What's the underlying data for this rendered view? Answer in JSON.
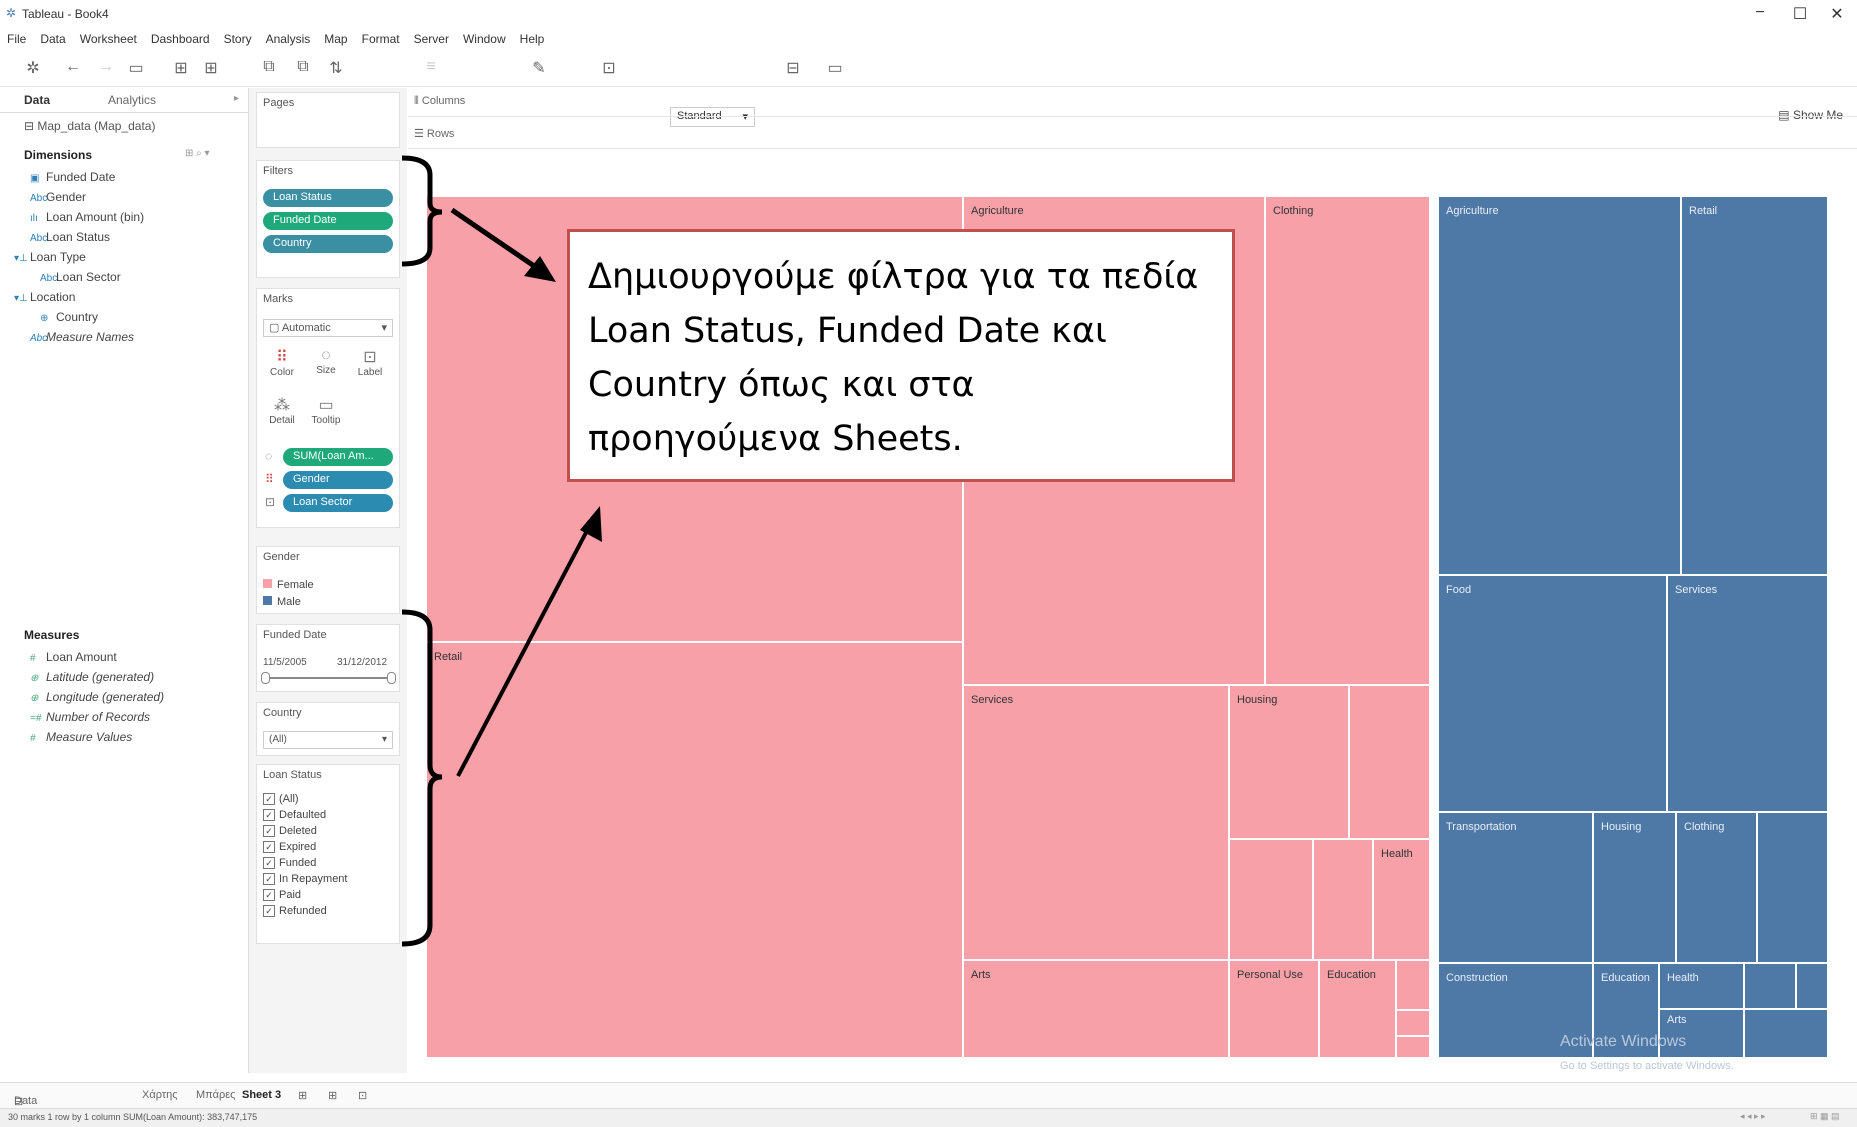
{
  "window": {
    "title": "Tableau - Book4",
    "min": "−",
    "max": "☐",
    "close": "✕"
  },
  "menu": [
    "File",
    "Data",
    "Worksheet",
    "Dashboard",
    "Story",
    "Analysis",
    "Map",
    "Format",
    "Server",
    "Window",
    "Help"
  ],
  "toolbar": {
    "fit_select": "Standard",
    "show_me": "Show Me"
  },
  "left_panel": {
    "tabs": [
      "Data",
      "Analytics"
    ],
    "datasource": "Map_data (Map_data)",
    "dimensions_title": "Dimensions",
    "dimensions": [
      "Funded Date",
      "Gender",
      "Loan Amount (bin)",
      "Loan Status",
      "Loan Type",
      "Loan Sector",
      "Location",
      "Country",
      "Measure Names"
    ],
    "measures_title": "Measures",
    "measures": [
      "Loan Amount",
      "Latitude (generated)",
      "Longitude (generated)",
      "Number of Records",
      "Measure Values"
    ]
  },
  "pages": {
    "title": "Pages"
  },
  "filters": {
    "title": "Filters",
    "pills": [
      "Loan Status",
      "Funded Date",
      "Country"
    ]
  },
  "marks": {
    "title": "Marks",
    "type": "Automatic",
    "buttons": [
      "Color",
      "Size",
      "Label",
      "Detail",
      "Tooltip"
    ],
    "pills": [
      "SUM(Loan Am...",
      "Gender",
      "Loan Sector"
    ]
  },
  "legend": {
    "title": "Gender",
    "items": [
      {
        "label": "Female",
        "color": "#f8a0a8"
      },
      {
        "label": "Male",
        "color": "#4e79a7"
      }
    ]
  },
  "funded_date": {
    "title": "Funded Date",
    "from": "11/5/2005",
    "to": "31/12/2012"
  },
  "country": {
    "title": "Country",
    "value": "(All)"
  },
  "loan_status": {
    "title": "Loan Status",
    "items": [
      "(All)",
      "Defaulted",
      "Deleted",
      "Expired",
      "Funded",
      "In Repayment",
      "Paid",
      "Refunded"
    ]
  },
  "shelves": {
    "columns": "Columns",
    "rows": "Rows"
  },
  "treemap": {
    "female_labels": [
      "Retail",
      "Agriculture",
      "Clothing",
      "Services",
      "Housing",
      "Health",
      "Arts",
      "Personal Use",
      "Education"
    ],
    "male_labels": [
      "Agriculture",
      "Retail",
      "Food",
      "Services",
      "Transportation",
      "Housing",
      "Clothing",
      "Construction",
      "Education",
      "Health",
      "Arts"
    ]
  },
  "callout": {
    "text": "Δημιουργούμε φίλτρα για τα πεδία Loan Status, Funded Date και Country όπως και στα προηγούμενα Sheets."
  },
  "sheet_tabs": {
    "datasource": "Data Source",
    "tabs": [
      "Χάρτης",
      "Μπάρες",
      "Sheet 3"
    ]
  },
  "status": {
    "text": "30 marks   1 row by 1 column   SUM(Loan Amount): 383,747,175"
  },
  "watermark": {
    "line1": "Activate Windows",
    "line2": "Go to Settings to activate Windows."
  }
}
